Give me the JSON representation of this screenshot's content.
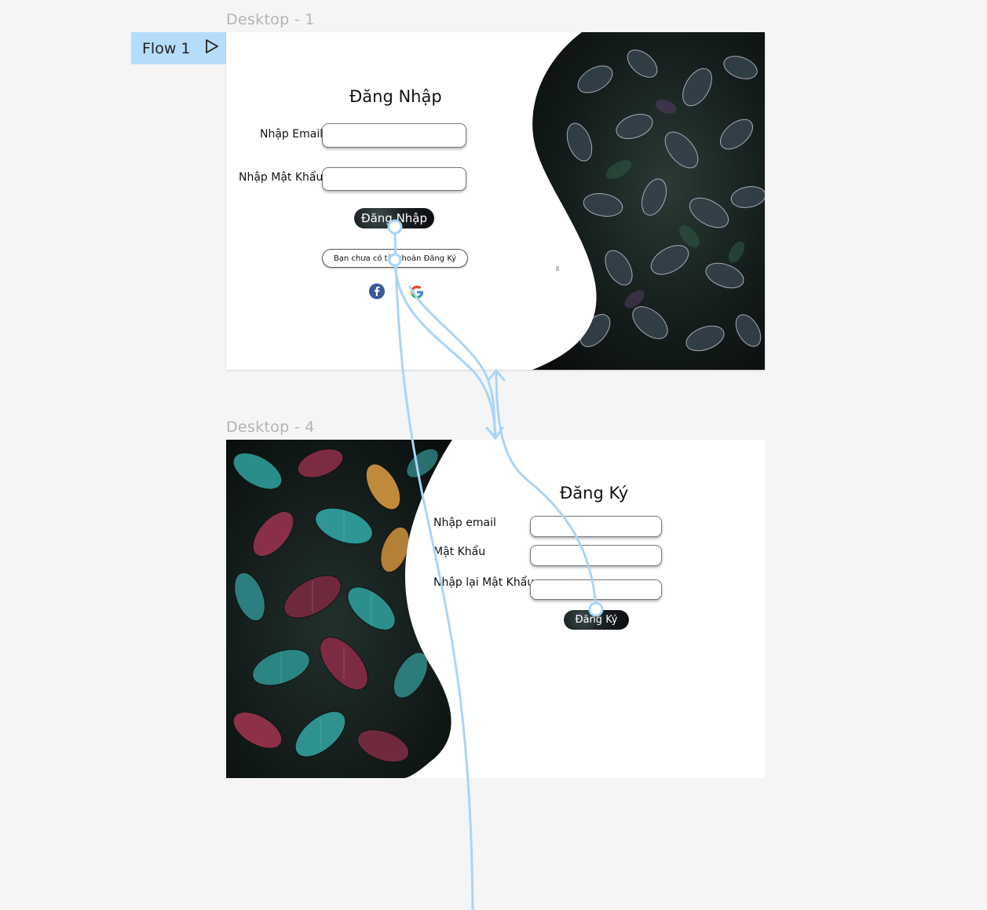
{
  "canvas": {
    "frame1_title": "Desktop - 1",
    "frame2_title": "Desktop - 4",
    "flow_label": "Flow 1"
  },
  "login": {
    "title": "Đăng Nhập",
    "email_label": "Nhập Email",
    "password_label": "Nhập Mật Khẩu",
    "submit_label": "Đăng Nhập",
    "register_link": "Bạn chưa có tài khoản Đăng Ký"
  },
  "register": {
    "title": "Đăng Ký",
    "email_label": "Nhập email",
    "password_label": "Mật Khẩu",
    "confirm_label": "Nhập lại Mật Khẩu",
    "submit_label": "Đăng Ký"
  },
  "icons": {
    "facebook": "facebook-icon",
    "google": "google-icon",
    "play": "play-icon"
  },
  "colors": {
    "flow_accent": "#b6dcfb",
    "connector": "#9fd0f5",
    "foliage_dark": "#1b2622",
    "foliage_teal": "#2e8c8a",
    "foliage_red": "#7a2a3d"
  }
}
